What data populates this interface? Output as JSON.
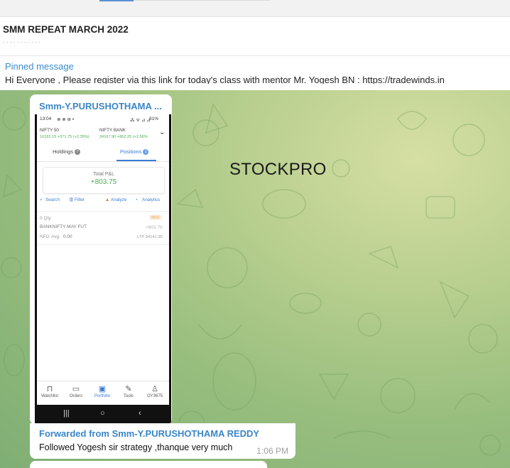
{
  "chat": {
    "title": "SMM REPEAT MARCH 2022",
    "subtitle": ". .  .  .  .  .  .  . .  .  .",
    "pinned_label": "Pinned message",
    "pinned_text": "Hi Everyone , Please register via this link for today's class with mentor Mr. Yogesh BN : https://tradewinds.in"
  },
  "watermark": "STOCKPRO",
  "message": {
    "sender": "Smm-Y.PURUSHOTHAMA ...",
    "forwarded_from": "Forwarded from Smm-Y.PURUSHOTHAMA REDDY",
    "text": "Followed Yogesh sir strategy ,thanque very much",
    "time": "1:06 PM"
  },
  "screenshot": {
    "status_time": "13:04",
    "status_right": "81%",
    "nifty50_label": "NIFTY 50",
    "nifty50_value": "16181.15 +371.75 (+2.35%)",
    "niftybank_label": "NIFTY BANK",
    "niftybank_value": "34167.90 +862.25 (+2.56%",
    "tab_holdings": "Holdings",
    "tab_holdings_count": "7",
    "tab_positions": "Positions",
    "tab_positions_count": "1",
    "pnl_label": "Total P&L",
    "pnl_value": "+803.75",
    "search": "Search",
    "filter": "Filter",
    "analyze": "Analyze",
    "analytics": "Analytics",
    "position": {
      "qty": "0 Qty.",
      "product": "MIS",
      "symbol": "BANKNIFTY MAY FUT",
      "pnl": "+803.75",
      "exchange": "NFO",
      "avg_label": "Avg.",
      "avg_value": "0.00",
      "ltp": "LTP 34141.95"
    },
    "nav": [
      "Watchlist",
      "Orders",
      "Portfolio",
      "Tools",
      "OY3675"
    ]
  },
  "colors": {
    "accent": "#3a86c8",
    "green": "#4caf50",
    "chat_bg": "#a7c586"
  }
}
